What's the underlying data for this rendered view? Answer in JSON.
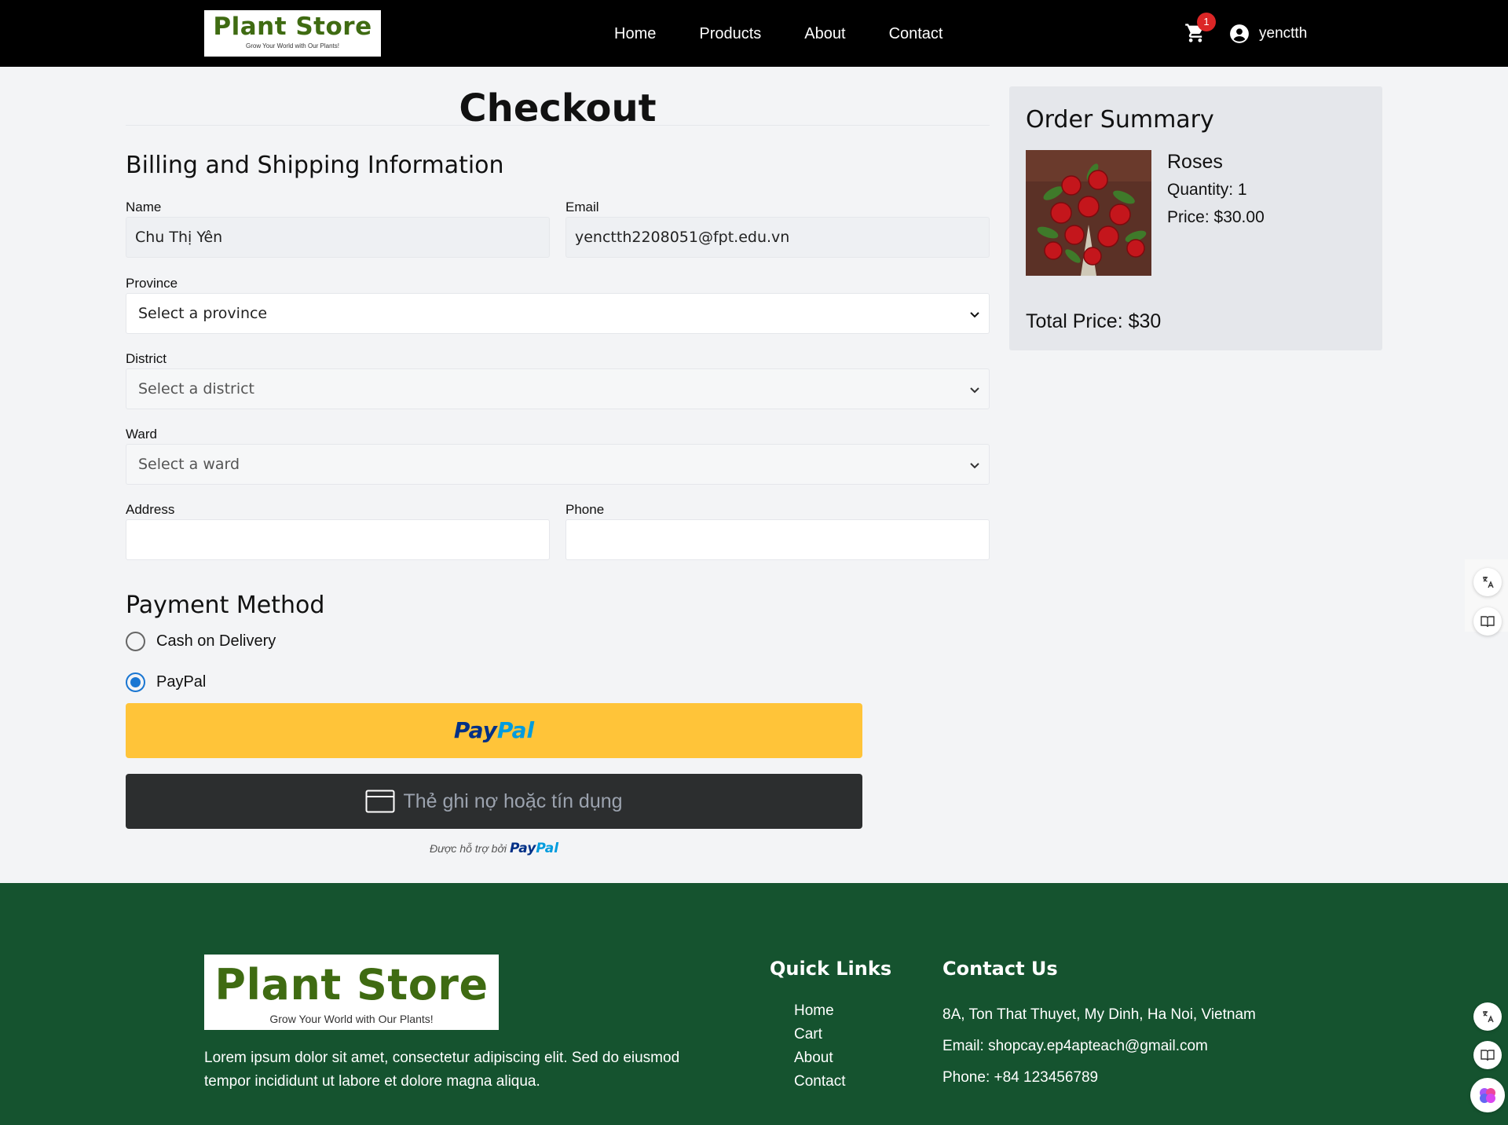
{
  "header": {
    "logo_title": "Plant Store",
    "logo_tagline": "Grow Your World with Our Plants!",
    "nav": [
      "Home",
      "Products",
      "About",
      "Contact"
    ],
    "cart_count": "1",
    "username": "yenctth"
  },
  "checkout": {
    "title": "Checkout",
    "billing_heading": "Billing and Shipping Information",
    "name_label": "Name",
    "name_value": "Chu Thị Yên",
    "email_label": "Email",
    "email_value": "yenctth2208051@fpt.edu.vn",
    "province_label": "Province",
    "province_value": "Select a province",
    "district_label": "District",
    "district_value": "Select a district",
    "ward_label": "Ward",
    "ward_value": "Select a ward",
    "address_label": "Address",
    "address_value": "",
    "phone_label": "Phone",
    "phone_value": "",
    "payment_heading": "Payment Method",
    "payment_options": [
      "Cash on Delivery",
      "PayPal"
    ],
    "selected_payment": "PayPal",
    "paypal_word_1": "Pay",
    "paypal_word_2": "Pal",
    "card_button_text": "Thẻ ghi nợ hoặc tín dụng",
    "powered_by": "Được hỗ trợ bởi"
  },
  "summary": {
    "title": "Order Summary",
    "product_name": "Roses",
    "quantity": "Quantity: 1",
    "price": "Price: $30.00",
    "total": "Total Price: $30"
  },
  "footer": {
    "logo_title": "Plant Store",
    "logo_tagline": "Grow Your World with Our Plants!",
    "about_text": "Lorem ipsum dolor sit amet, consectetur adipiscing elit. Sed do eiusmod tempor incididunt ut labore et dolore magna aliqua.",
    "quick_links_heading": "Quick Links",
    "quick_links": [
      "Home",
      "Cart",
      "About",
      "Contact"
    ],
    "contact_heading": "Contact Us",
    "address": "8A, Ton That Thuyet, My Dinh, Ha Noi, Vietnam",
    "email": "Email: shopcay.ep4apteach@gmail.com",
    "phone": "Phone: +84 123456789"
  },
  "colors": {
    "header_bg": "#000000",
    "logo_green": "#3f6b12",
    "footer_bg": "#15532f",
    "paypal_yellow": "#ffc439",
    "card_button_bg": "#2c2e2f",
    "radio_blue": "#1976d2",
    "badge_red": "#dc2626"
  }
}
